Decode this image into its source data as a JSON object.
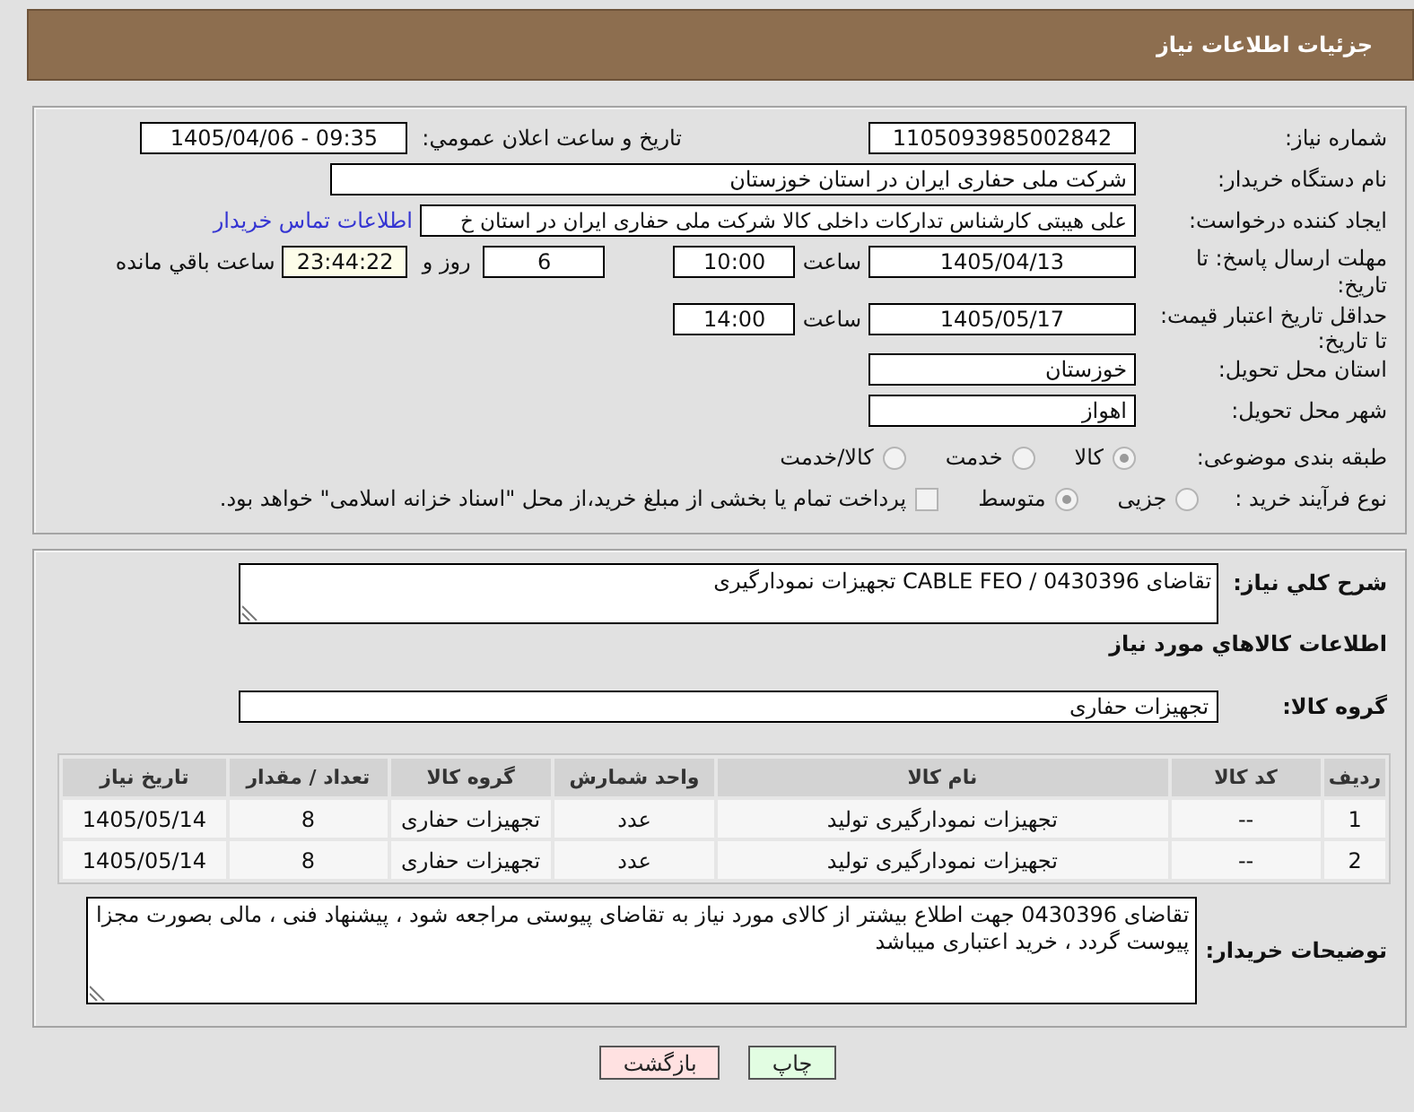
{
  "header": {
    "title": "جزئیات اطلاعات نیاز"
  },
  "details": {
    "rows": [
      {
        "kind": "pair",
        "label": "شماره نیاز:",
        "value": "1105093985002842",
        "label_2": "تاریخ و ساعت اعلان عمومي:",
        "value_2": "1405/04/06 - 09:35"
      },
      {
        "kind": "wide",
        "label": "نام دستگاه خریدار:",
        "value": "شرکت ملی حفاری ایران در استان خوزستان"
      },
      {
        "kind": "link",
        "label": "ایجاد کننده درخواست:",
        "value": "علی هیبتی کارشناس تدارکات داخلی کالا شرکت ملی حفاری ایران در استان خ",
        "link": "اطلاعات تماس خریدار"
      },
      {
        "kind": "deadline",
        "label": "مهلت ارسال پاسخ: تا تاریخ:",
        "date": "1405/04/13",
        "time_label": "ساعت",
        "time": "10:00",
        "days": "6",
        "days_label": "روز و",
        "remaining": "23:44:22",
        "remaining_label": "ساعت باقي مانده"
      },
      {
        "kind": "date_time",
        "label": "حداقل تاریخ اعتبار قیمت: تا تاریخ:",
        "date": "1405/05/17",
        "time_label": "ساعت",
        "time": "14:00"
      },
      {
        "kind": "short",
        "label": "استان محل تحویل:",
        "value": "خوزستان"
      },
      {
        "kind": "short",
        "label": "شهر محل تحویل:",
        "value": "اهواز"
      },
      {
        "kind": "radios",
        "label": "طبقه بندی موضوعی:",
        "options": [
          {
            "label": "کالا",
            "selected": true
          },
          {
            "label": "خدمت",
            "selected": false
          },
          {
            "label": "کالا/خدمت",
            "selected": false
          }
        ]
      },
      {
        "kind": "purchase",
        "label": "نوع فرآیند خرید :",
        "options": [
          {
            "label": "جزیی",
            "selected": false
          },
          {
            "label": "متوسط",
            "selected": true
          }
        ],
        "checkbox": {
          "label": "پرداخت تمام یا بخشی از مبلغ خرید،از محل \"اسناد خزانه اسلامی\" خواهد بود.",
          "checked": false
        }
      }
    ]
  },
  "summary": {
    "label": "شرح کلي نیاز:",
    "value": "تقاضای 0430396 / CABLE FEO تجهیزات نمودارگیری"
  },
  "items": {
    "title": "اطلاعات کالاهاي مورد نیاز",
    "group_label": "گروه کالا:",
    "group_value": "تجهیزات حفاری",
    "table": {
      "columns": [
        "ردیف",
        "کد کالا",
        "نام کالا",
        "واحد شمارش",
        "گروه کالا",
        "تعداد / مقدار",
        "تاریخ نیاز"
      ],
      "rows": [
        [
          "1",
          "--",
          "تجهیزات نمودارگیری تولید",
          "عدد",
          "تجهیزات حفاری",
          "8",
          "1405/05/14"
        ],
        [
          "2",
          "--",
          "تجهیزات نمودارگیری تولید",
          "عدد",
          "تجهیزات حفاری",
          "8",
          "1405/05/14"
        ]
      ]
    }
  },
  "notes": {
    "label": "توضیحات خریدار:",
    "value": "تقاضای 0430396 جهت اطلاع بیشتر از کالای مورد نیاز به تقاضای پیوستی مراجعه شود ، پیشنهاد فنی ، مالی بصورت مجزا پیوست گردد ، خرید اعتباری میباشد"
  },
  "buttons": [
    {
      "kind": "print",
      "label": "چاپ"
    },
    {
      "kind": "back",
      "label": "بازگشت"
    }
  ]
}
